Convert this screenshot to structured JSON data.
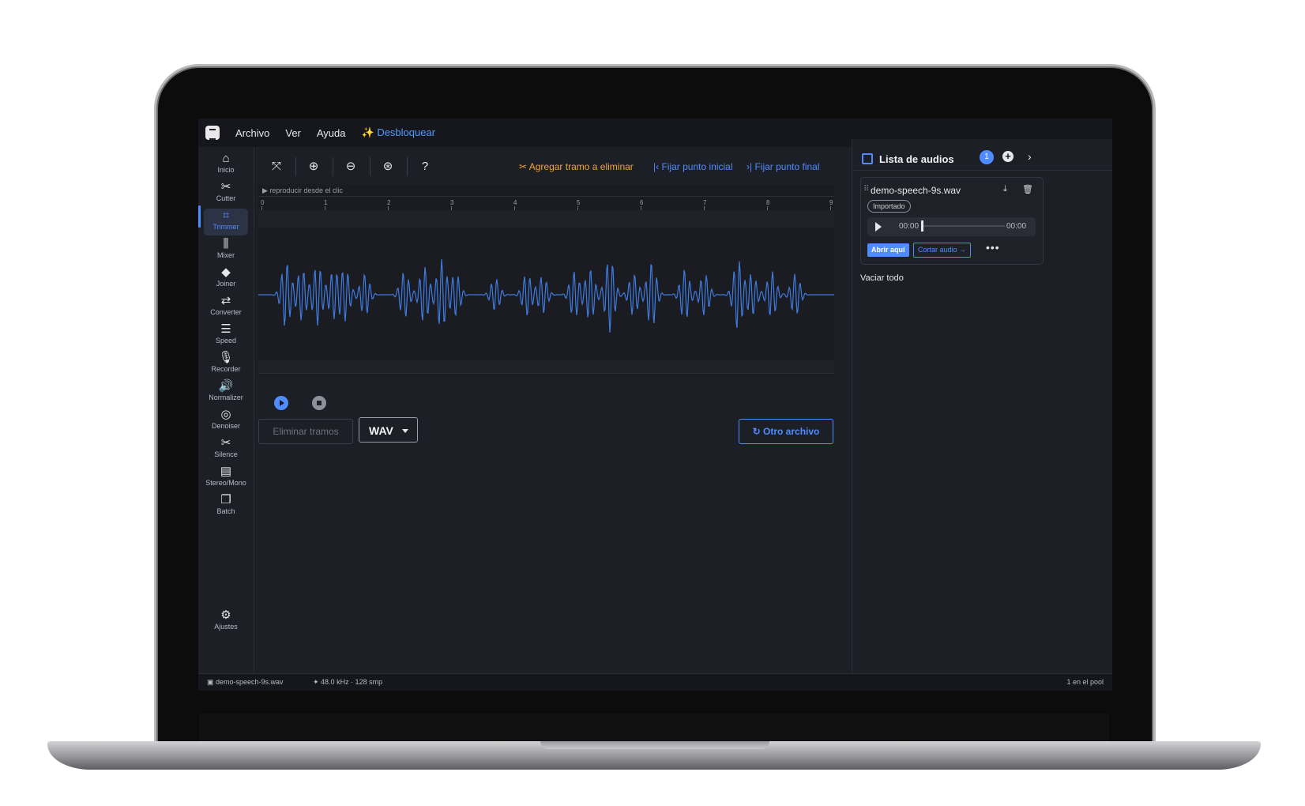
{
  "menubar": {
    "items": [
      "Archivo",
      "Ver",
      "Ayuda"
    ],
    "unlock": "✨ Desbloquear"
  },
  "sidebar": {
    "items": [
      {
        "icon": "home-icon",
        "glyph": "⌂",
        "label": "Inicio"
      },
      {
        "icon": "scissors-icon",
        "glyph": "✂",
        "label": "Cutter"
      },
      {
        "icon": "crop-icon",
        "glyph": "⌗",
        "label": "Trimmer",
        "active": true
      },
      {
        "icon": "sliders-icon",
        "glyph": "⫼",
        "label": "Mixer"
      },
      {
        "icon": "layers-icon",
        "glyph": "◆",
        "label": "Joiner"
      },
      {
        "icon": "swap-icon",
        "glyph": "⇄",
        "label": "Converter"
      },
      {
        "icon": "tune-icon",
        "glyph": "☰",
        "label": "Speed"
      },
      {
        "icon": "mic-icon",
        "glyph": "🎙",
        "label": "Recorder"
      },
      {
        "icon": "volume-icon",
        "glyph": "🔊",
        "label": "Normalizer"
      },
      {
        "icon": "denoise-icon",
        "glyph": "◎",
        "label": "Denoiser"
      },
      {
        "icon": "scissors-icon",
        "glyph": "✂",
        "label": "Silence"
      },
      {
        "icon": "speaker-icon",
        "glyph": "▤",
        "label": "Stereo/Mono"
      },
      {
        "icon": "library-icon",
        "glyph": "❐",
        "label": "Batch"
      }
    ],
    "settings": {
      "icon": "gear-icon",
      "glyph": "⚙",
      "label": "Ajustes"
    }
  },
  "toolbar": {
    "add_cut": "Agregar tramo a eliminar",
    "set_start": "Fijar punto inicial",
    "set_end": "Fijar punto final"
  },
  "waveform": {
    "hint": "▶ reproducir desde el clic",
    "ticks": [
      "0",
      "1",
      "2",
      "3",
      "4",
      "5",
      "6",
      "7",
      "8",
      "9"
    ],
    "color": "#3f7be0"
  },
  "actions": {
    "remove_segments": "Eliminar tramos",
    "format": "WAV",
    "other_file": "Otro archivo"
  },
  "right_panel": {
    "title": "Lista de audios",
    "count": "1",
    "file": {
      "name": "demo-speech-9s.wav",
      "tag": "Importado",
      "time_current": "00:00",
      "time_total": "00:00",
      "open_here": "Abrir aquí",
      "cut_audio": "Cortar audio →",
      "more": "•••"
    },
    "clear_all": "Vaciar todo"
  },
  "status": {
    "file": "demo-speech-9s.wav",
    "format": "48.0 kHz · 128 smp",
    "pool": "1 en el pool"
  },
  "colors": {
    "accent": "#4f8cff",
    "orange": "#f0a53a",
    "bg": "#1c1f26"
  }
}
